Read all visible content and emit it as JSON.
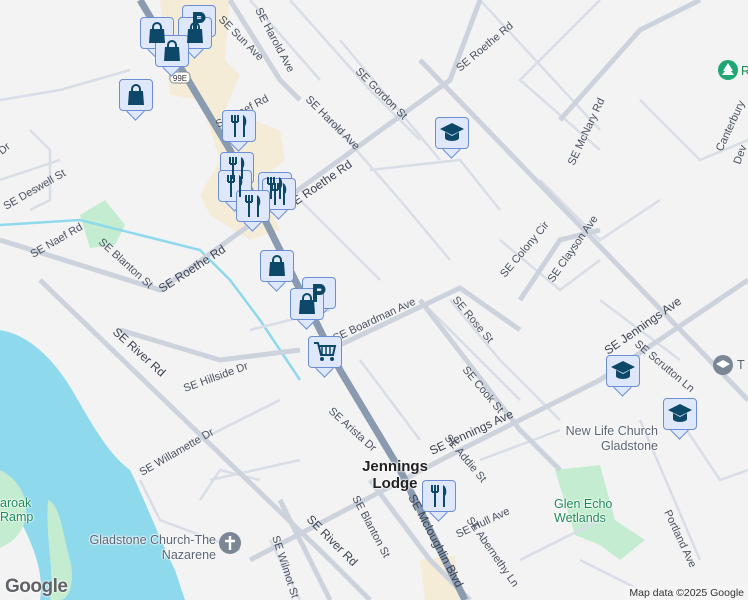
{
  "map": {
    "streets": {
      "harold_ave_top": "SE Harold Ave",
      "sun_ave": "SE Sun Ave",
      "roethe_rd_top": "SE Roethe Rd",
      "gordon_st": "SE Gordon St",
      "harold_ave": "SE Harold Ave",
      "mcnary_rd": "SE McNary Rd",
      "naef_rd_top": "SE Naef Rd",
      "deswell_st": "SE Deswell St",
      "dr_left": "Dr",
      "roethe_rd_mid": "SE Roethe Rd",
      "naef_rd": "SE Naef Rd",
      "blanton_st_top": "SE Blanton St",
      "roethe_rd": "SE Roethe Rd",
      "colony_cir": "SE Colony Cir",
      "clayson_ave": "SE Clayson Ave",
      "canterbury": "Canterbury",
      "dev": "Dev",
      "jennings_ave_right": "SE Jennings Ave",
      "scrutton_ln": "SE Scrutton Ln",
      "boardman_ave": "SE Boardman Ave",
      "rose_st": "SE Rose St",
      "river_rd_top": "SE River Rd",
      "hillside_dr": "SE Hillside Dr",
      "cook_st": "SE Cook St",
      "jennings_ave": "SE Jennings Ave",
      "arista_dr": "SE Arista Dr",
      "willamette_dr": "SE Willamette Dr",
      "addie_st": "SE Addie St",
      "hull_ave": "SE Hull Ave",
      "blanton_st": "SE Blanton St",
      "mcloughlin_blvd": "SE Mcloughlin Blvd",
      "abernethy_ln": "SE Abernethy Ln",
      "river_rd": "SE River Rd",
      "wilmot_st": "SE Wilmot St",
      "portland_ave": "Portland Ave",
      "highway_shield": "99E"
    },
    "places": {
      "town": "Jennings Lodge",
      "church_nazarene": "Gladstone Church-The Nazarene",
      "new_life_church": "New Life Church Gladstone",
      "glen_echo": "Glen Echo Wetlands",
      "ramp": "aroak Ramp",
      "park_right_partial": "R",
      "school_right_partial": "T G"
    },
    "markers": [
      {
        "type": "parking"
      },
      {
        "type": "shopping"
      },
      {
        "type": "shopping"
      },
      {
        "type": "shopping"
      },
      {
        "type": "shopping"
      },
      {
        "type": "restaurant"
      },
      {
        "type": "restaurant"
      },
      {
        "type": "restaurant"
      },
      {
        "type": "restaurant"
      },
      {
        "type": "restaurant"
      },
      {
        "type": "restaurant"
      },
      {
        "type": "parking"
      },
      {
        "type": "shopping"
      },
      {
        "type": "shopping"
      },
      {
        "type": "grocery"
      },
      {
        "type": "restaurant"
      },
      {
        "type": "school"
      },
      {
        "type": "school"
      },
      {
        "type": "school"
      }
    ],
    "attribution": "Map data ©2025 Google",
    "logo": "Google",
    "colors": {
      "water": "#8fd9ec",
      "park": "#c3ecd0",
      "highway": "#8a9bb0",
      "marker_icon": "#0d4868",
      "marker_bg": "#dfe8fb"
    }
  }
}
